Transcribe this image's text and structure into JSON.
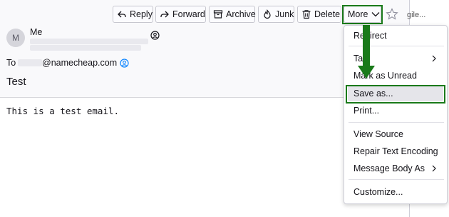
{
  "toolbar": {
    "reply_label": "Reply",
    "forward_label": "Forward",
    "archive_label": "Archive",
    "junk_label": "Junk",
    "delete_label": "Delete",
    "more_label": "More"
  },
  "message": {
    "sender_initial": "M",
    "sender_name": "Me",
    "to_label": "To",
    "to_address_suffix": "@namecheap.com",
    "subject": "Test",
    "body": "This is a test email."
  },
  "menu": {
    "items": [
      {
        "label": "Redirect"
      },
      {
        "label": "Tag",
        "submenu": true
      },
      {
        "label": "Mark as Unread"
      },
      {
        "label": "Save as..."
      },
      {
        "label": "Print..."
      },
      {
        "label": "View Source"
      },
      {
        "label": "Repair Text Encoding"
      },
      {
        "label": "Message Body As",
        "submenu": true
      },
      {
        "label": "Customize..."
      }
    ]
  },
  "side_text": {
    "top": "gile..."
  },
  "colors": {
    "highlight": "#1a7a1a",
    "contact_icon": "#0a84ff",
    "hover": "#e5e5ea"
  },
  "icons": [
    "reply-icon",
    "forward-icon",
    "archive-icon",
    "junk-icon",
    "delete-icon",
    "chevron-down-icon",
    "star-icon",
    "contact-icon",
    "chevron-right-icon",
    "arrow-down-annotation"
  ]
}
